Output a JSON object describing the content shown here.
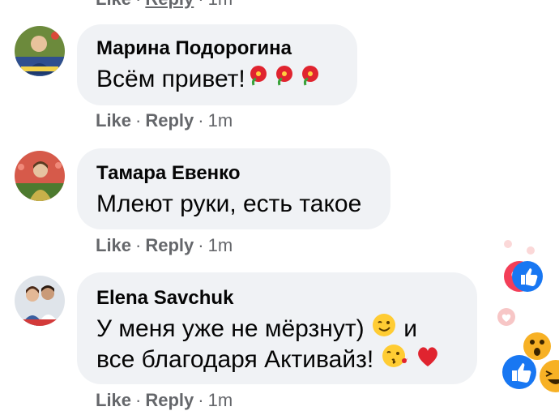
{
  "top_actions": {
    "like": "Like",
    "reply": "Reply",
    "time": "1m"
  },
  "comments": [
    {
      "author": "Марина Подорогина",
      "text": "Всём привет!",
      "actions": {
        "like": "Like",
        "reply": "Reply",
        "time": "1m"
      },
      "trailing_emoji": [
        "hibiscus-emoji",
        "hibiscus-emoji",
        "hibiscus-emoji"
      ]
    },
    {
      "author": "Тамара Евенко",
      "text": "Млеют руки, есть такое",
      "actions": {
        "like": "Like",
        "reply": "Reply",
        "time": "1m"
      }
    },
    {
      "author": "Elena Savchuk",
      "text_line1": "У меня уже не мёрзнут)",
      "text_line1_end": "и",
      "text_line2": "все благодаря Активайз!",
      "actions": {
        "like": "Like",
        "reply": "Reply",
        "time": "1m"
      },
      "emoji": [
        "winking-emoji",
        "kissing-emoji",
        "red-heart-emoji"
      ]
    }
  ],
  "colors": {
    "bubble": "#f0f2f5",
    "meta_text": "#65676b",
    "like_blue": "#1877f2",
    "love_red": "#f33e58",
    "wow_yellow": "#f7b125"
  },
  "reactions_floating": [
    "love-icon",
    "like-icon",
    "wow-icon",
    "like-icon",
    "haha-icon"
  ]
}
